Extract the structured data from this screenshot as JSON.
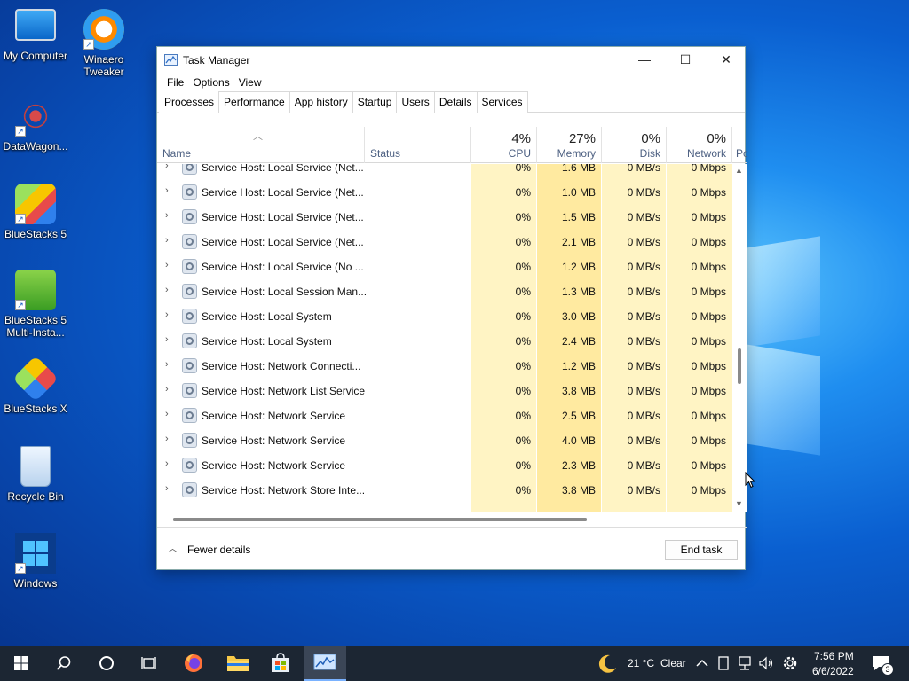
{
  "desktop": {
    "icons": [
      {
        "label": "My Computer"
      },
      {
        "label": "Winaero Tweaker"
      },
      {
        "label": "DataWagon..."
      },
      {
        "label": "BlueStacks 5"
      },
      {
        "label": "BlueStacks 5 Multi-Insta..."
      },
      {
        "label": "BlueStacks X"
      },
      {
        "label": "Recycle Bin"
      },
      {
        "label": "Windows"
      }
    ]
  },
  "window": {
    "title": "Task Manager",
    "menu": [
      "File",
      "Options",
      "View"
    ],
    "tabs": [
      "Processes",
      "Performance",
      "App history",
      "Startup",
      "Users",
      "Details",
      "Services"
    ],
    "active_tab": "Processes",
    "columns": {
      "name": "Name",
      "status": "Status",
      "cpu": {
        "pct": "4%",
        "label": "CPU"
      },
      "memory": {
        "pct": "27%",
        "label": "Memory"
      },
      "disk": {
        "pct": "0%",
        "label": "Disk"
      },
      "network": {
        "pct": "0%",
        "label": "Network"
      },
      "power": "Po"
    },
    "rows": [
      {
        "name": "Service Host: Local Service (Net...",
        "cpu": "0%",
        "mem": "1.6 MB",
        "disk": "0 MB/s",
        "net": "0 Mbps"
      },
      {
        "name": "Service Host: Local Service (Net...",
        "cpu": "0%",
        "mem": "1.0 MB",
        "disk": "0 MB/s",
        "net": "0 Mbps"
      },
      {
        "name": "Service Host: Local Service (Net...",
        "cpu": "0%",
        "mem": "1.5 MB",
        "disk": "0 MB/s",
        "net": "0 Mbps"
      },
      {
        "name": "Service Host: Local Service (Net...",
        "cpu": "0%",
        "mem": "2.1 MB",
        "disk": "0 MB/s",
        "net": "0 Mbps"
      },
      {
        "name": "Service Host: Local Service (No ...",
        "cpu": "0%",
        "mem": "1.2 MB",
        "disk": "0 MB/s",
        "net": "0 Mbps"
      },
      {
        "name": "Service Host: Local Session Man...",
        "cpu": "0%",
        "mem": "1.3 MB",
        "disk": "0 MB/s",
        "net": "0 Mbps"
      },
      {
        "name": "Service Host: Local System",
        "cpu": "0%",
        "mem": "3.0 MB",
        "disk": "0 MB/s",
        "net": "0 Mbps"
      },
      {
        "name": "Service Host: Local System",
        "cpu": "0%",
        "mem": "2.4 MB",
        "disk": "0 MB/s",
        "net": "0 Mbps"
      },
      {
        "name": "Service Host: Network Connecti...",
        "cpu": "0%",
        "mem": "1.2 MB",
        "disk": "0 MB/s",
        "net": "0 Mbps"
      },
      {
        "name": "Service Host: Network List Service",
        "cpu": "0%",
        "mem": "3.8 MB",
        "disk": "0 MB/s",
        "net": "0 Mbps"
      },
      {
        "name": "Service Host: Network Service",
        "cpu": "0%",
        "mem": "2.5 MB",
        "disk": "0 MB/s",
        "net": "0 Mbps"
      },
      {
        "name": "Service Host: Network Service",
        "cpu": "0%",
        "mem": "4.0 MB",
        "disk": "0 MB/s",
        "net": "0 Mbps"
      },
      {
        "name": "Service Host: Network Service",
        "cpu": "0%",
        "mem": "2.3 MB",
        "disk": "0 MB/s",
        "net": "0 Mbps"
      },
      {
        "name": "Service Host: Network Store Inte...",
        "cpu": "0%",
        "mem": "3.8 MB",
        "disk": "0 MB/s",
        "net": "0 Mbps"
      }
    ],
    "footer": {
      "fewer_details": "Fewer details",
      "end_task": "End task"
    }
  },
  "taskbar": {
    "weather": {
      "temp": "21 °C",
      "condition": "Clear"
    },
    "time": "7:56 PM",
    "date": "6/6/2022",
    "notification_count": "3"
  }
}
